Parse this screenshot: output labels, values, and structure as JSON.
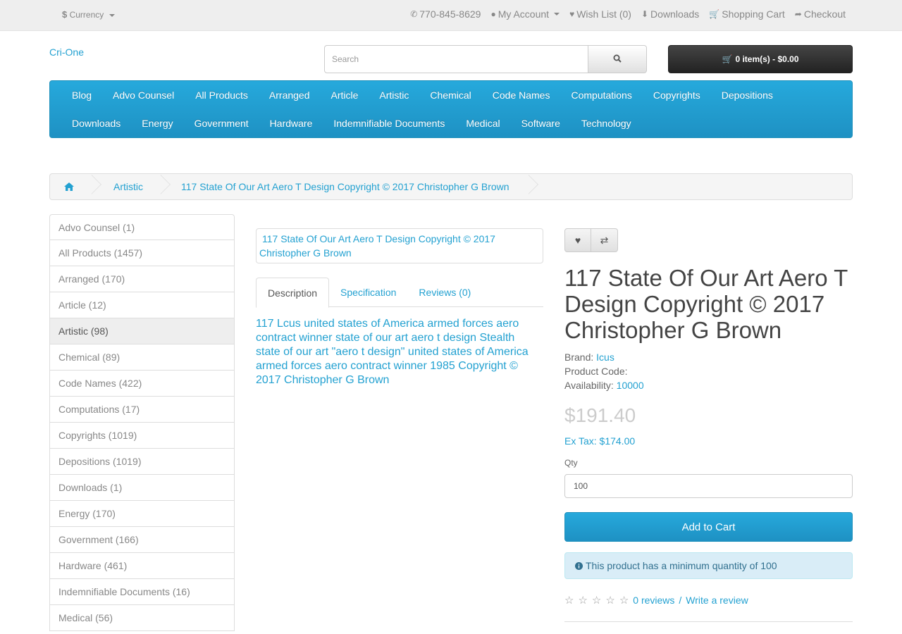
{
  "top": {
    "currency": "Currency",
    "phone": "770-845-8629",
    "my_account": "My Account",
    "wish_list": "Wish List (0)",
    "downloads": "Downloads",
    "shopping_cart": "Shopping Cart",
    "checkout": "Checkout"
  },
  "header": {
    "logo_alt": "Cri-One",
    "search_placeholder": "Search",
    "cart_summary": "0 item(s) - $0.00"
  },
  "menu": {
    "row1": [
      "Blog",
      "Advo Counsel",
      "All Products",
      "Arranged",
      "Article",
      "Artistic",
      "Chemical",
      "Code Names",
      "Computations",
      "Copyrights",
      "Depositions"
    ],
    "row2": [
      "Downloads",
      "Energy",
      "Government",
      "Hardware",
      "Indemnifiable Documents",
      "Medical",
      "Software",
      "Technology"
    ]
  },
  "breadcrumb": {
    "category": "Artistic",
    "current": "117 State Of Our Art Aero T Design Copyright © 2017 Christopher G Brown"
  },
  "sidebar": [
    {
      "label": "Advo Counsel (1)"
    },
    {
      "label": "All Products (1457)"
    },
    {
      "label": "Arranged (170)"
    },
    {
      "label": "Article (12)"
    },
    {
      "label": "Artistic (98)",
      "active": true
    },
    {
      "label": "Chemical (89)"
    },
    {
      "label": "Code Names (422)"
    },
    {
      "label": "Computations (17)"
    },
    {
      "label": "Copyrights (1019)"
    },
    {
      "label": "Depositions (1019)"
    },
    {
      "label": "Downloads (1)"
    },
    {
      "label": "Energy (170)"
    },
    {
      "label": "Government (166)"
    },
    {
      "label": "Hardware (461)"
    },
    {
      "label": "Indemnifiable Documents (16)"
    },
    {
      "label": "Medical (56)"
    }
  ],
  "product": {
    "image_alt": "117 State Of Our Art Aero T Design Copyright © 2017 Christopher G Brown",
    "tabs": [
      "Description",
      "Specification",
      "Reviews (0)"
    ],
    "description": "117 Lcus united states of America armed forces aero contract winner  state of our art aero t design Stealth state of our art \"aero t design\" united states of America armed forces aero contract winner 1985 Copyright © 2017 Christopher G Brown",
    "title": "117 State Of Our Art Aero T Design Copyright © 2017 Christopher G Brown",
    "brand_label": "Brand:",
    "brand": "Icus",
    "code_label": "Product Code:",
    "availability_label": "Availability:",
    "availability": "10000",
    "price": "$191.40",
    "ex_tax": "Ex Tax: $174.00",
    "qty_label": "Qty",
    "qty_value": "100",
    "add_to_cart": "Add to Cart",
    "min_qty_notice": "This product has a minimum quantity of 100",
    "reviews_link": "0 reviews",
    "rating_sep": "/",
    "write_review": "Write a review",
    "rating_stars": 0,
    "rating_max": 5
  },
  "colors": {
    "accent": "#23a1d1",
    "menu_bg": "#229ac8",
    "cart_bg": "#303030",
    "alert_bg": "#d9edf7"
  }
}
